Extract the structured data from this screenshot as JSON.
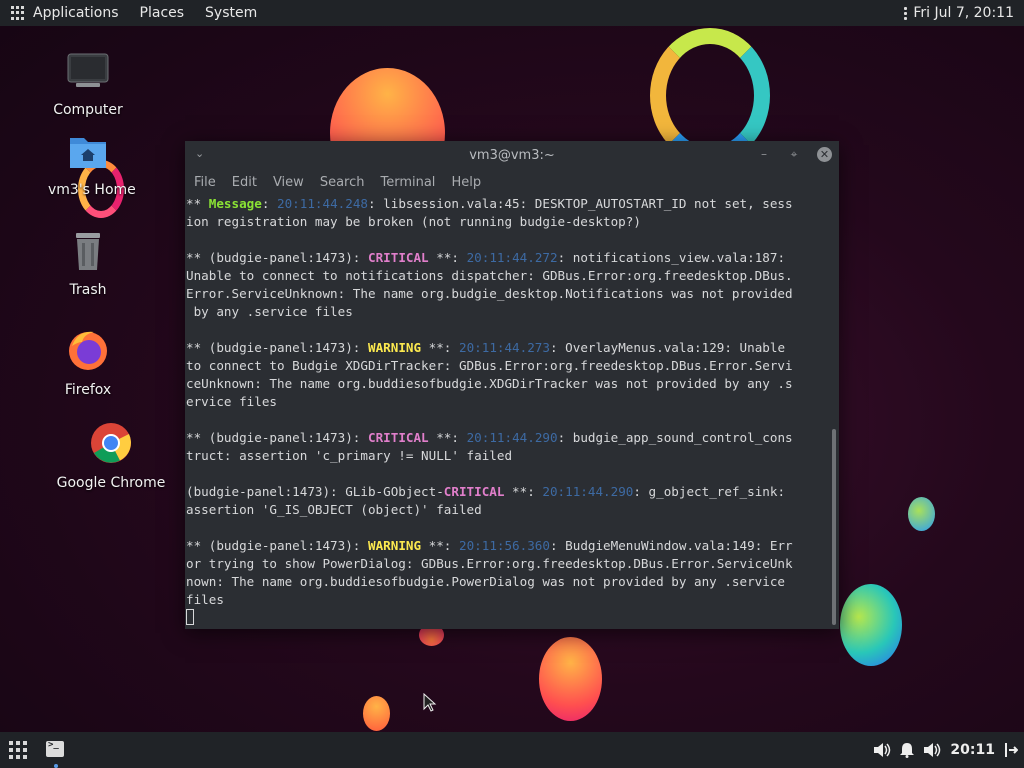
{
  "top_panel": {
    "menus": [
      "Applications",
      "Places",
      "System"
    ],
    "clock": "Fri Jul  7, 20:11"
  },
  "desktop": {
    "icons": [
      {
        "label": "Computer",
        "icon": "computer-icon"
      },
      {
        "label": "vm3's Home",
        "icon": "home-folder-icon"
      },
      {
        "label": "Trash",
        "icon": "trash-icon"
      },
      {
        "label": "Firefox",
        "icon": "firefox-icon"
      },
      {
        "label": "Google Chrome",
        "icon": "chrome-icon"
      }
    ]
  },
  "terminal": {
    "title": "vm3@vm3:~",
    "menu": [
      "File",
      "Edit",
      "View",
      "Search",
      "Terminal",
      "Help"
    ],
    "lines": [
      [
        [
          "plain",
          "** "
        ],
        [
          "msg",
          "Message"
        ],
        [
          "plain",
          ": "
        ],
        [
          "ts",
          "20:11:44.248"
        ],
        [
          "plain",
          ": libsession.vala:45: DESKTOP_AUTOSTART_ID not set, sess"
        ]
      ],
      [
        [
          "plain",
          "ion registration may be broken (not running budgie-desktop?)"
        ]
      ],
      [
        [
          "plain",
          ""
        ]
      ],
      [
        [
          "plain",
          "** (budgie-panel:1473): "
        ],
        [
          "crit",
          "CRITICAL"
        ],
        [
          "plain",
          " **: "
        ],
        [
          "ts",
          "20:11:44.272"
        ],
        [
          "plain",
          ": notifications_view.vala:187:"
        ]
      ],
      [
        [
          "plain",
          "Unable to connect to notifications dispatcher: GDBus.Error:org.freedesktop.DBus."
        ]
      ],
      [
        [
          "plain",
          "Error.ServiceUnknown: The name org.budgie_desktop.Notifications was not provided"
        ]
      ],
      [
        [
          "plain",
          " by any .service files"
        ]
      ],
      [
        [
          "plain",
          ""
        ]
      ],
      [
        [
          "plain",
          "** (budgie-panel:1473): "
        ],
        [
          "warn",
          "WARNING"
        ],
        [
          "plain",
          " **: "
        ],
        [
          "ts",
          "20:11:44.273"
        ],
        [
          "plain",
          ": OverlayMenus.vala:129: Unable"
        ]
      ],
      [
        [
          "plain",
          "to connect to Budgie XDGDirTracker: GDBus.Error:org.freedesktop.DBus.Error.Servi"
        ]
      ],
      [
        [
          "plain",
          "ceUnknown: The name org.buddiesofbudgie.XDGDirTracker was not provided by any .s"
        ]
      ],
      [
        [
          "plain",
          "ervice files"
        ]
      ],
      [
        [
          "plain",
          ""
        ]
      ],
      [
        [
          "plain",
          "** (budgie-panel:1473): "
        ],
        [
          "crit",
          "CRITICAL"
        ],
        [
          "plain",
          " **: "
        ],
        [
          "ts",
          "20:11:44.290"
        ],
        [
          "plain",
          ": budgie_app_sound_control_cons"
        ]
      ],
      [
        [
          "plain",
          "truct: assertion 'c_primary != NULL' failed"
        ]
      ],
      [
        [
          "plain",
          ""
        ]
      ],
      [
        [
          "plain",
          "(budgie-panel:1473): GLib-GObject-"
        ],
        [
          "crit",
          "CRITICAL"
        ],
        [
          "plain",
          " **: "
        ],
        [
          "ts",
          "20:11:44.290"
        ],
        [
          "plain",
          ": g_object_ref_sink:"
        ]
      ],
      [
        [
          "plain",
          "assertion 'G_IS_OBJECT (object)' failed"
        ]
      ],
      [
        [
          "plain",
          ""
        ]
      ],
      [
        [
          "plain",
          "** (budgie-panel:1473): "
        ],
        [
          "warn",
          "WARNING"
        ],
        [
          "plain",
          " **: "
        ],
        [
          "ts",
          "20:11:56.360"
        ],
        [
          "plain",
          ": BudgieMenuWindow.vala:149: Err"
        ]
      ],
      [
        [
          "plain",
          "or trying to show PowerDialog: GDBus.Error:org.freedesktop.DBus.Error.ServiceUnk"
        ]
      ],
      [
        [
          "plain",
          "nown: The name org.buddiesofbudgie.PowerDialog was not provided by any .service"
        ]
      ],
      [
        [
          "plain",
          "files"
        ]
      ]
    ]
  },
  "bottom_panel": {
    "clock": "20:11"
  },
  "colors": {
    "panel": "#202327",
    "terminal_bg": "#2b2e33",
    "message": "#8ae234",
    "critical": "#e17fcb",
    "warning": "#fce94f",
    "timestamp": "#3d6aa3"
  }
}
